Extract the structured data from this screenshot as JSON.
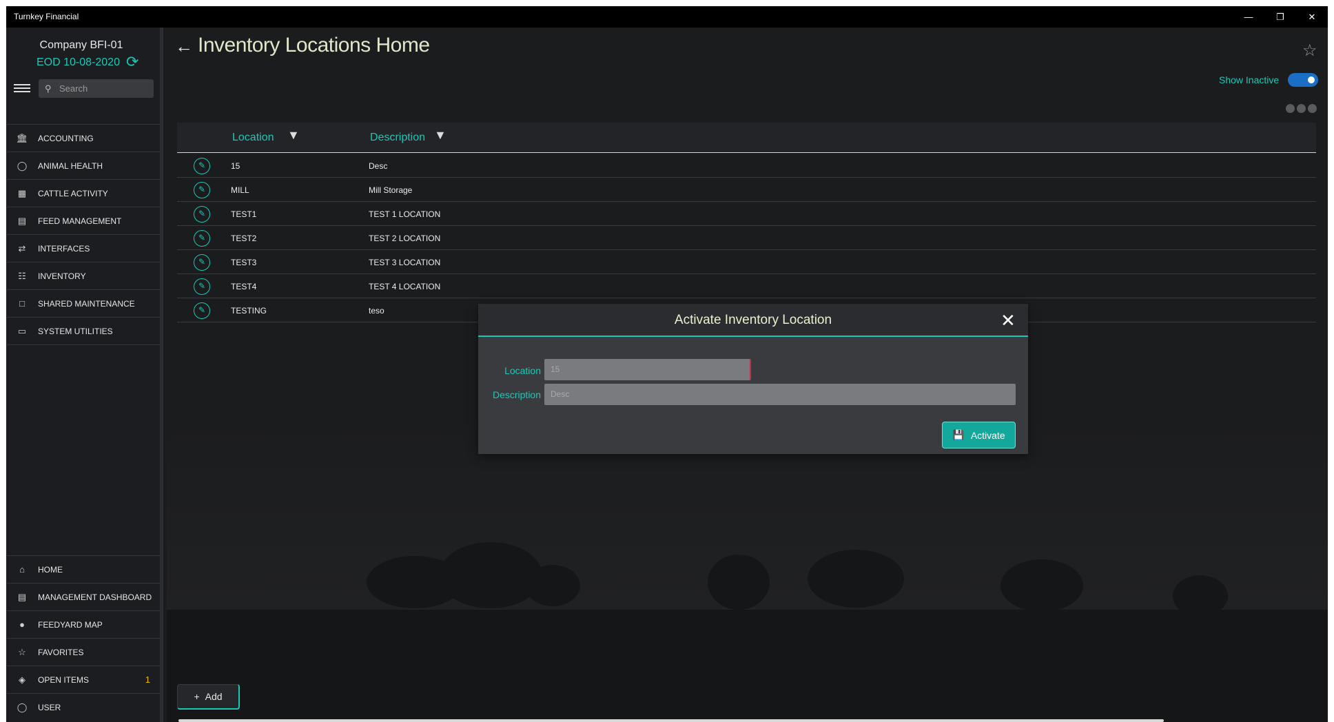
{
  "window": {
    "title": "Turnkey Financial"
  },
  "sidebar": {
    "company": "Company BFI-01",
    "eod": "EOD 10-08-2020",
    "search_placeholder": "Search",
    "items": [
      {
        "label": "ACCOUNTING",
        "icon": "bank-icon"
      },
      {
        "label": "ANIMAL HEALTH",
        "icon": "tag-icon"
      },
      {
        "label": "CATTLE ACTIVITY",
        "icon": "grid-icon"
      },
      {
        "label": "FEED MANAGEMENT",
        "icon": "feed-icon"
      },
      {
        "label": "INTERFACES",
        "icon": "interfaces-icon"
      },
      {
        "label": "INVENTORY",
        "icon": "clipboard-icon"
      },
      {
        "label": "SHARED MAINTENANCE",
        "icon": "folder-icon"
      },
      {
        "label": "SYSTEM UTILITIES",
        "icon": "monitor-icon"
      }
    ],
    "bottom_items": [
      {
        "label": "HOME",
        "icon": "home-icon"
      },
      {
        "label": "MANAGEMENT DASHBOARD",
        "icon": "dashboard-icon"
      },
      {
        "label": "FEEDYARD MAP",
        "icon": "globe-icon"
      },
      {
        "label": "FAVORITES",
        "icon": "star-icon"
      },
      {
        "label": "OPEN ITEMS",
        "icon": "layers-icon",
        "badge": "1"
      },
      {
        "label": "USER",
        "icon": "user-icon"
      }
    ]
  },
  "page": {
    "title": "Inventory Locations Home",
    "show_inactive_label": "Show Inactive",
    "show_inactive": true,
    "add_label": "Add"
  },
  "grid": {
    "columns": [
      "Location",
      "Description"
    ],
    "rows": [
      {
        "location": "15",
        "description": "Desc"
      },
      {
        "location": "MILL",
        "description": "Mill Storage"
      },
      {
        "location": "TEST1",
        "description": "TEST 1 LOCATION"
      },
      {
        "location": "TEST2",
        "description": "TEST 2 LOCATION"
      },
      {
        "location": "TEST3",
        "description": "TEST 3 LOCATION"
      },
      {
        "location": "TEST4",
        "description": "TEST 4 LOCATION"
      },
      {
        "location": "TESTING",
        "description": "teso"
      }
    ]
  },
  "dialog": {
    "title": "Activate Inventory Location",
    "location_label": "Location",
    "location_value": "15",
    "description_label": "Description",
    "description_value": "Desc",
    "activate_label": "Activate"
  },
  "colors": {
    "accent": "#19c9b7",
    "background": "#1b1c1e",
    "toggle": "#1a6fc4"
  }
}
